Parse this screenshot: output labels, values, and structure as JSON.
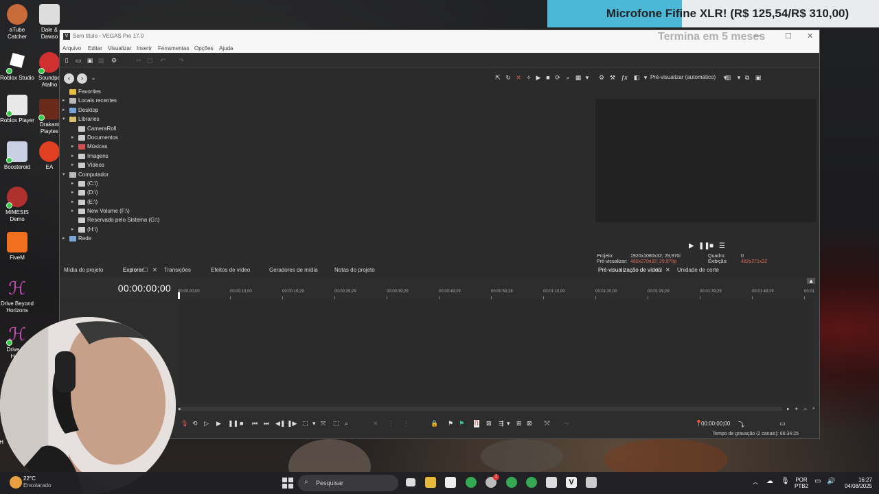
{
  "desktop_icons": [
    {
      "label": "aTube Catcher",
      "color": "#c86a3a"
    },
    {
      "label": "Roblox Studio",
      "color": "#ffffff"
    },
    {
      "label": "Roblox Player",
      "color": "#e8e8e8"
    },
    {
      "label": "Boosteroid",
      "color": "#c9d0e6"
    },
    {
      "label": "MIMESIS Demo",
      "color": "#b03030"
    },
    {
      "label": "FiveM",
      "color": "#f07020"
    },
    {
      "label": "Drive Beyond Horizons",
      "color": "#c040b0"
    },
    {
      "label": "Drive Be Horiz",
      "color": "#c040b0"
    },
    {
      "label": "Dale & Dawso",
      "color": "#dddddd"
    },
    {
      "label": "Soundpa Atalho",
      "color": "#d03030"
    },
    {
      "label": "Drakant Playtes",
      "color": "#6a2a1a"
    },
    {
      "label": "EA",
      "color": "#e04020"
    },
    {
      "label": "H",
      "color": "#999999"
    }
  ],
  "banner": {
    "text": "Microfone Fifine XLR! (R$ 125,54/R$ 310,00)",
    "progress": 0.405,
    "ends": "Termina em 5 meses"
  },
  "window": {
    "title": "Sem título - VEGAS Pro 17.0",
    "app_icon": "V",
    "min": "—",
    "max": "☐",
    "close": "✕",
    "menu": [
      "Arquivo",
      "Editar",
      "Visualizar",
      "Inserir",
      "Ferramentas",
      "Opções",
      "Ajuda"
    ]
  },
  "explorer_tree": [
    {
      "label": "Favorites",
      "level": 0,
      "arrow": "",
      "icon": "star"
    },
    {
      "label": "Locais recentes",
      "level": 0,
      "arrow": "▸",
      "icon": "clock"
    },
    {
      "label": "Desktop",
      "level": 0,
      "arrow": "▸",
      "icon": "desktop"
    },
    {
      "label": "Libraries",
      "level": 0,
      "arrow": "▾",
      "icon": "folder"
    },
    {
      "label": "CameraRoll",
      "level": 1,
      "arrow": "",
      "icon": "lib"
    },
    {
      "label": "Documentos",
      "level": 1,
      "arrow": "▸",
      "icon": "lib"
    },
    {
      "label": "Músicas",
      "level": 1,
      "arrow": "▸",
      "icon": "music"
    },
    {
      "label": "Imagens",
      "level": 1,
      "arrow": "▸",
      "icon": "lib"
    },
    {
      "label": "Vídeos",
      "level": 1,
      "arrow": "▸",
      "icon": "lib"
    },
    {
      "label": "Computador",
      "level": 0,
      "arrow": "▾",
      "icon": "pc"
    },
    {
      "label": "(C:\\)",
      "level": 1,
      "arrow": "▸",
      "icon": "drive"
    },
    {
      "label": "(D:\\)",
      "level": 1,
      "arrow": "▸",
      "icon": "drive"
    },
    {
      "label": "(E:\\)",
      "level": 1,
      "arrow": "▸",
      "icon": "drive"
    },
    {
      "label": "New Volume (F:\\)",
      "level": 1,
      "arrow": "▸",
      "icon": "drive"
    },
    {
      "label": "Reservado pelo Sistema (G:\\)",
      "level": 1,
      "arrow": "",
      "icon": "drive"
    },
    {
      "label": "(H:\\)",
      "level": 1,
      "arrow": "▸",
      "icon": "drive"
    },
    {
      "label": "Rede",
      "level": 0,
      "arrow": "▸",
      "icon": "net"
    }
  ],
  "preview": {
    "mode": "Pré-visualizar (automático)",
    "projeto_label": "Projeto:",
    "projeto_value": "1920x1080x32; 29,970i",
    "previsualizar_label": "Pré-visualizar:",
    "previsualizar_value": "480x270x32; 29,970p",
    "quadro_label": "Quadro:",
    "quadro_value": "0",
    "exibicao_label": "Exibição:",
    "exibicao_value": "482x271x32",
    "value_color": "#e06a5a"
  },
  "tabs_left": [
    "Mídia do projeto",
    "Explorer",
    "Transições",
    "Efeitos de vídeo",
    "Geradores de mídia",
    "Notas do projeto"
  ],
  "tabs_right": [
    "Pré-visualização de vídeo",
    "Unidade de corte"
  ],
  "timeline": {
    "timecode": "00:00:00;00",
    "ruler": [
      "00:00:00;00",
      "00:00:10;00",
      "00:00:19;29",
      "00:00:29;29",
      "00:00:39;29",
      "00:00:49;29",
      "00:00:59;28",
      "00:01:10;00",
      "00:01:20;00",
      "00:01:29;29",
      "00:01:39;29",
      "00:01:49;29",
      "00:01"
    ],
    "cursor_time": "00:00:00;00",
    "status": "Tempo de gravação (2 canais): 66:34:25"
  },
  "taskbar": {
    "temp": "22°C",
    "weather": "Ensolarado",
    "search": "Pesquisar",
    "lang1": "POR",
    "lang2": "PTB2",
    "time": "16:27",
    "date": "04/08/2025",
    "badge": "2"
  }
}
